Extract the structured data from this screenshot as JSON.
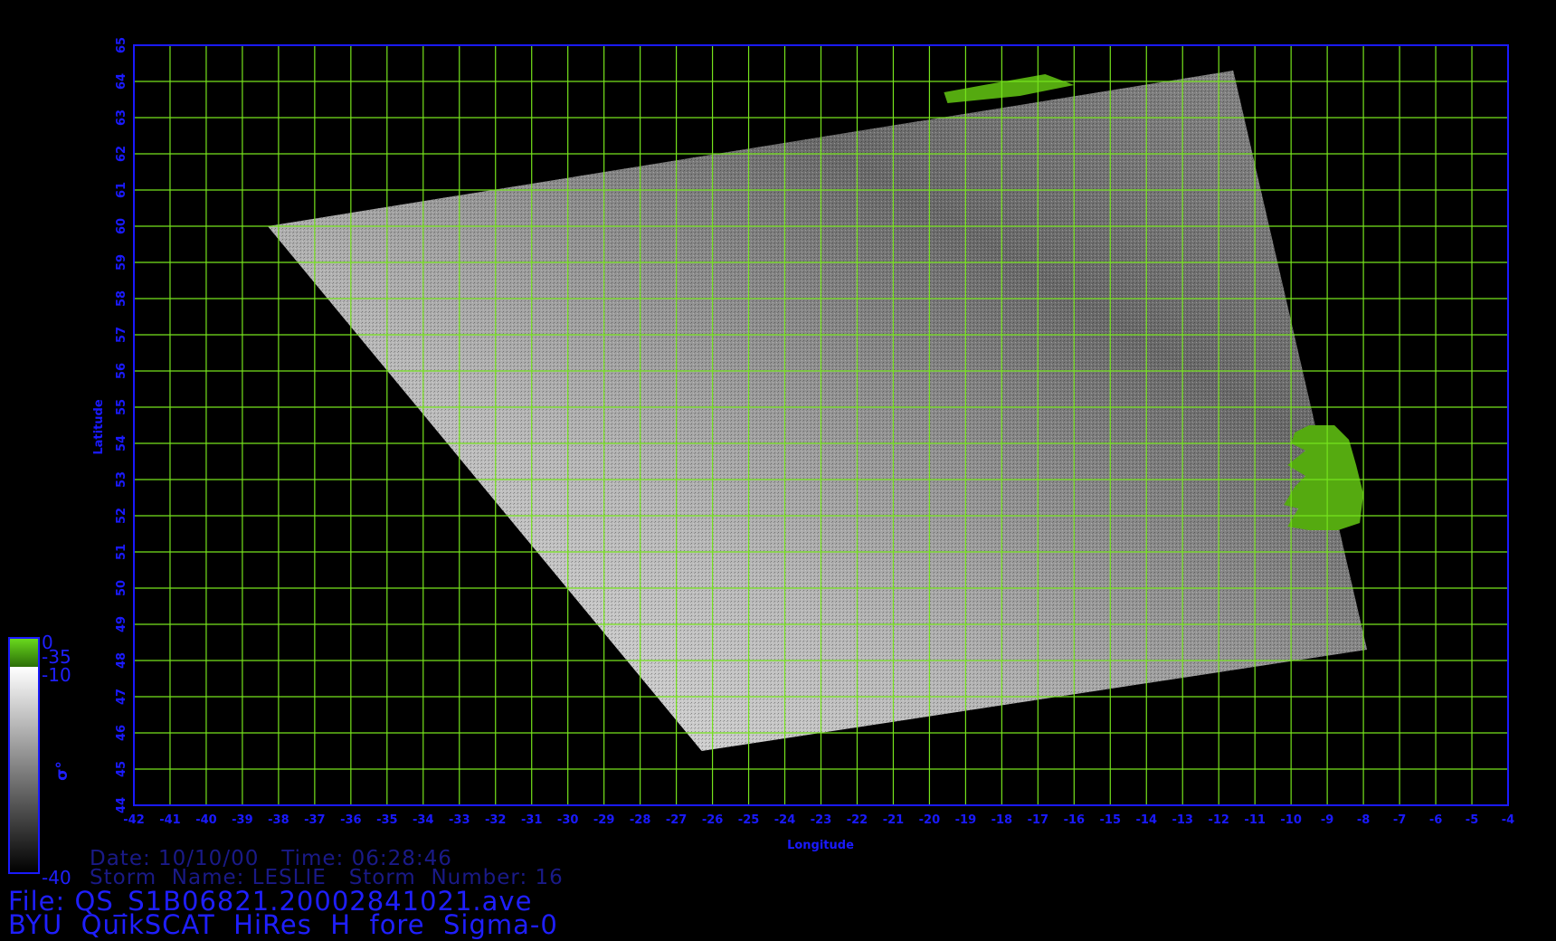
{
  "map": {
    "lon_min": -42,
    "lon_max": -4,
    "lat_min": 44,
    "lat_max": 65,
    "lon_ticks": [
      -42,
      -41,
      -40,
      -39,
      -38,
      -37,
      -36,
      -35,
      -34,
      -33,
      -32,
      -31,
      -30,
      -29,
      -28,
      -27,
      -26,
      -25,
      -24,
      -23,
      -22,
      -21,
      -20,
      -19,
      -18,
      -17,
      -16,
      -15,
      -14,
      -13,
      -12,
      -11,
      -10,
      -9,
      -8,
      -7,
      -6,
      -5,
      -4
    ],
    "lat_ticks": [
      44,
      45,
      46,
      47,
      48,
      49,
      50,
      51,
      52,
      53,
      54,
      55,
      56,
      57,
      58,
      59,
      60,
      61,
      62,
      63,
      64,
      65
    ],
    "x_label": "Longitude",
    "y_label": "Latitude",
    "swath_corners_lonlat": [
      [
        -38.3,
        60.0
      ],
      [
        -11.6,
        64.3
      ],
      [
        -7.9,
        48.3
      ],
      [
        -26.3,
        45.5
      ]
    ],
    "land": {
      "ireland_outline_lonlat": [
        [
          -9.9,
          54.3
        ],
        [
          -9.5,
          54.5
        ],
        [
          -8.8,
          54.5
        ],
        [
          -8.4,
          54.1
        ],
        [
          -8.2,
          53.4
        ],
        [
          -8.0,
          52.6
        ],
        [
          -8.1,
          51.8
        ],
        [
          -8.7,
          51.6
        ],
        [
          -9.5,
          51.6
        ],
        [
          -10.1,
          51.7
        ],
        [
          -9.8,
          52.2
        ],
        [
          -10.2,
          52.3
        ],
        [
          -9.9,
          52.8
        ],
        [
          -9.6,
          53.1
        ],
        [
          -10.1,
          53.4
        ],
        [
          -9.6,
          53.8
        ],
        [
          -10.0,
          54.0
        ]
      ],
      "iceland_outline_lonlat": [
        [
          -19.5,
          63.4
        ],
        [
          -17.5,
          63.6
        ],
        [
          -16.0,
          63.9
        ],
        [
          -16.8,
          64.2
        ],
        [
          -18.5,
          63.9
        ],
        [
          -19.6,
          63.7
        ]
      ]
    },
    "colors": {
      "background": "#000000",
      "axis": "#1a1aff",
      "grid": "#76e31c",
      "land": "#55aa10",
      "swath_light": "#dedede",
      "swath_dark": "#4a4a4a"
    }
  },
  "colorbar": {
    "labels": [
      "0",
      "-35",
      "-10",
      "-40"
    ],
    "symbol": "σ°",
    "colors": {
      "top": "#6bdc1e",
      "bottom": "#2c6e08",
      "white": "#ffffff",
      "black": "#000000"
    }
  },
  "info": {
    "date_time": "Date: 10/10/00   Time: 06:28:46",
    "storm": "Storm  Name: LESLIE   Storm  Number: 16",
    "file": "File: QS_S1B06821.20002841021.ave",
    "title": "BYU  QuikSCAT  HiRes  H  fore  Sigma-0"
  }
}
